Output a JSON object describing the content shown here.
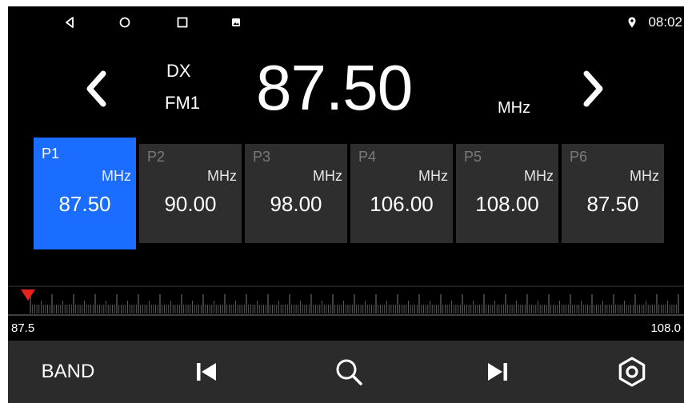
{
  "status_bar": {
    "icons": [
      "back-icon",
      "home-icon",
      "recents-icon",
      "gallery-icon",
      "location-icon"
    ],
    "time": "08:02"
  },
  "radio": {
    "dx_label": "DX",
    "band_label": "FM1",
    "frequency": "87.50",
    "unit": "MHz",
    "prev_icon": "chevron-left-icon",
    "next_icon": "chevron-right-icon"
  },
  "presets": [
    {
      "label": "P1",
      "unit": "MHz",
      "frequency": "87.50",
      "active": true
    },
    {
      "label": "P2",
      "unit": "MHz",
      "frequency": "90.00",
      "active": false
    },
    {
      "label": "P3",
      "unit": "MHz",
      "frequency": "98.00",
      "active": false
    },
    {
      "label": "P4",
      "unit": "MHz",
      "frequency": "106.00",
      "active": false
    },
    {
      "label": "P5",
      "unit": "MHz",
      "frequency": "108.00",
      "active": false
    },
    {
      "label": "P6",
      "unit": "MHz",
      "frequency": "87.50",
      "active": false
    }
  ],
  "tuner": {
    "min_label": "87.5",
    "max_label": "108.0",
    "min": 87.5,
    "max": 108.0,
    "current": 87.5,
    "marker_color": "#e8231c"
  },
  "bottom_bar": {
    "band_label": "BAND",
    "icons": [
      "skip-previous-icon",
      "search-icon",
      "skip-next-icon",
      "settings-icon"
    ]
  },
  "colors": {
    "accent": "#1a6dff",
    "preset_bg": "#2e2e2e",
    "bottom_bar_bg": "#2b2b2b"
  }
}
